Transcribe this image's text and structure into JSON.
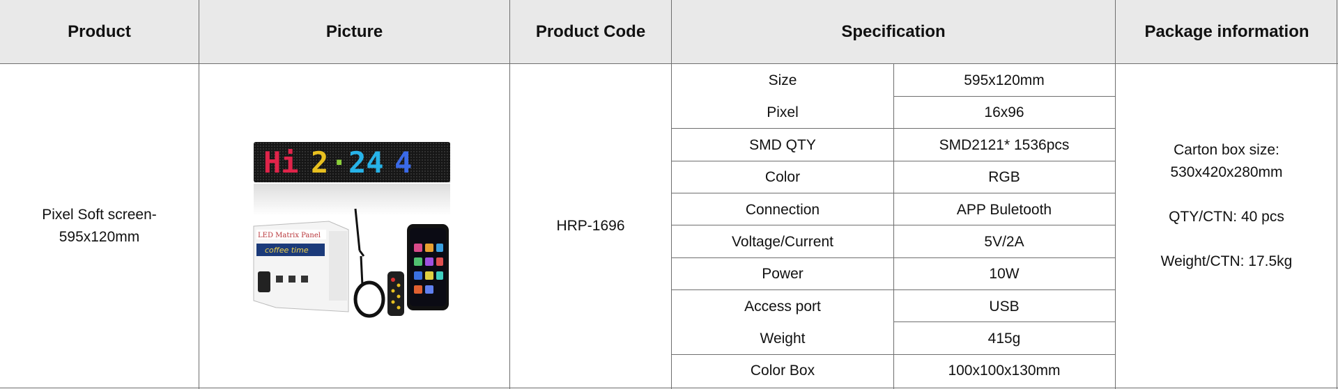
{
  "header": {
    "product": "Product",
    "picture": "Picture",
    "product_code": "Product Code",
    "specification": "Specification",
    "package_information": "Package information"
  },
  "row": {
    "product_name": [
      "Pixel Soft screen-",
      "595x120mm"
    ],
    "picture": {
      "sign_text": "Hi · 2 · 24 ·",
      "box_label": "LED Matrix Panel",
      "box_banner": "coffee time"
    },
    "product_code": "HRP-1696",
    "specs": [
      {
        "label": "Size",
        "value": "595x120mm"
      },
      {
        "label": "Pixel",
        "value": "16x96"
      },
      {
        "label": "SMD QTY",
        "value": "SMD2121* 1536pcs"
      },
      {
        "label": "Color",
        "value": "RGB"
      },
      {
        "label": "Connection",
        "value": "APP Buletooth"
      },
      {
        "label": "Voltage/Current",
        "value": "5V/2A"
      },
      {
        "label": "Power",
        "value": "10W"
      },
      {
        "label": "Access port",
        "value": "USB"
      },
      {
        "label": "Weight",
        "value": "415g"
      },
      {
        "label": "Color Box",
        "value": "100x100x130mm"
      }
    ],
    "package": {
      "carton_label": "Carton box size:",
      "carton_value": "530x420x280mm",
      "qty": "QTY/CTN: 40 pcs",
      "weight": "Weight/CTN: 17.5kg"
    }
  },
  "colors": {
    "header_bg": "#e9e9e9",
    "border": "#6e6e6e"
  }
}
